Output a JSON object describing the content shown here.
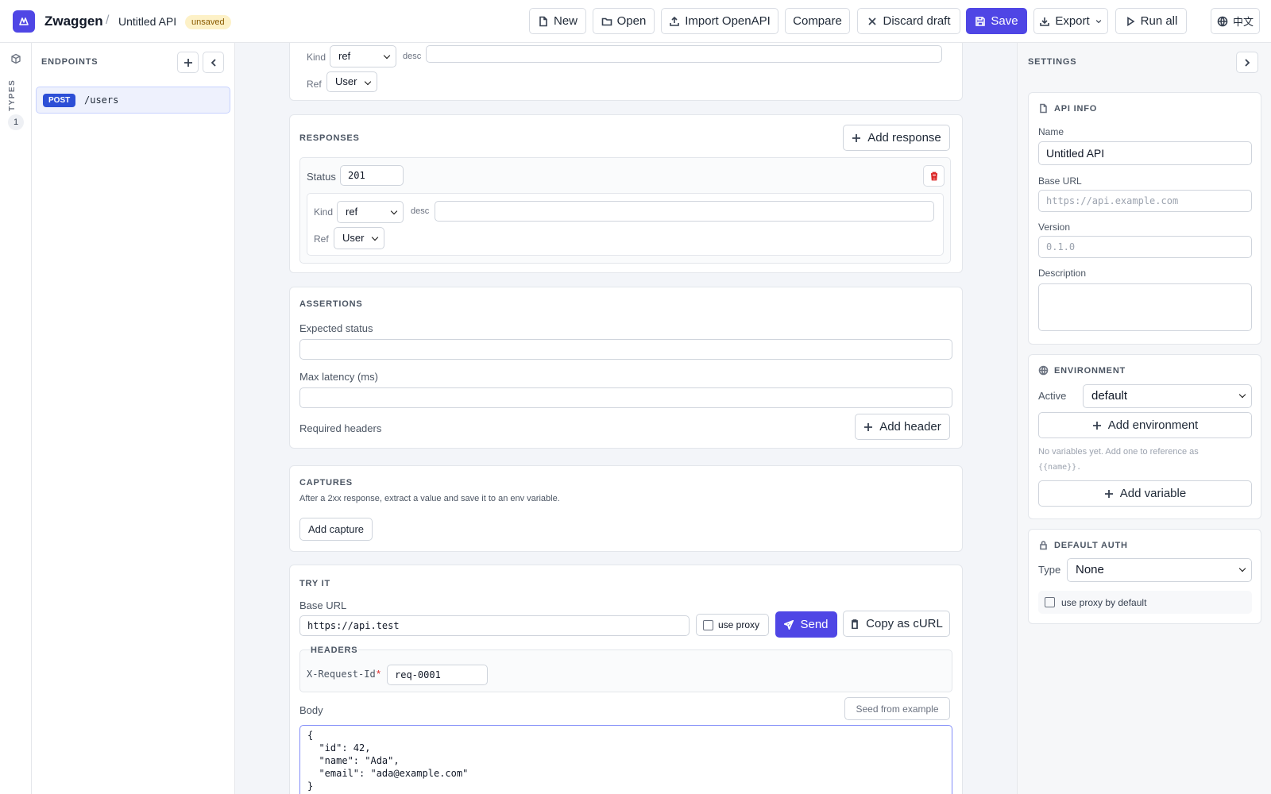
{
  "app": {
    "name": "Zwaggen",
    "api_title": "Untitled API",
    "status_badge": "unsaved",
    "accent": "#4f46e5"
  },
  "toolbar": {
    "new": "New",
    "open": "Open",
    "import": "Import OpenAPI",
    "compare": "Compare",
    "discard": "Discard draft",
    "save": "Save",
    "export": "Export",
    "run_all": "Run all",
    "language": "中文"
  },
  "rail": {
    "label": "TYPES",
    "count": "1"
  },
  "endpoints": {
    "title": "ENDPOINTS",
    "items": [
      {
        "method": "POST",
        "path": "/users"
      }
    ]
  },
  "request_body_partial": {
    "kind_label": "Kind",
    "kind_value": "ref",
    "desc_label": "desc",
    "ref_label": "Ref",
    "ref_value": "User"
  },
  "responses": {
    "title": "RESPONSES",
    "add_label": "Add response",
    "items": [
      {
        "status_label": "Status",
        "status": "201",
        "kind_label": "Kind",
        "kind": "ref",
        "desc_label": "desc",
        "desc": "",
        "ref_label": "Ref",
        "ref": "User"
      }
    ]
  },
  "assertions": {
    "title": "ASSERTIONS",
    "expected_status_label": "Expected status",
    "expected_status": "",
    "max_latency_label": "Max latency (ms)",
    "max_latency": "",
    "required_headers_label": "Required headers",
    "add_header": "Add header"
  },
  "captures": {
    "title": "CAPTURES",
    "hint": "After a 2xx response, extract a value and save it to an env variable.",
    "add_label": "Add capture"
  },
  "try_it": {
    "title": "TRY IT",
    "base_url_label": "Base URL",
    "base_url": "https://api.test",
    "use_proxy_label": "use proxy",
    "send_label": "Send",
    "copy_curl": "Copy as cURL",
    "headers_title": "HEADERS",
    "header_name": "X-Request-Id",
    "header_required": "*",
    "header_value": "req-0001",
    "body_label": "Body",
    "seed_label": "Seed from example",
    "body_lines": [
      "{",
      "  \"id\": 42,",
      "  \"name\": \"Ada\",",
      "  \"email\": \"ada@example.com\"",
      "}"
    ]
  },
  "settings": {
    "title": "SETTINGS",
    "api_info": {
      "title": "API INFO",
      "name_label": "Name",
      "name": "Untitled API",
      "base_url_label": "Base URL",
      "base_url_placeholder": "https://api.example.com",
      "version_label": "Version",
      "version_placeholder": "0.1.0",
      "description_label": "Description"
    },
    "environment": {
      "title": "ENVIRONMENT",
      "active_label": "Active",
      "active": "default",
      "add_env": "Add environment",
      "hint": "No variables yet. Add one to reference as",
      "hint_code": "{{name}}.",
      "add_var": "Add variable"
    },
    "default_auth": {
      "title": "DEFAULT AUTH",
      "type_label": "Type",
      "type": "None",
      "proxy_default": "use proxy by default"
    }
  }
}
